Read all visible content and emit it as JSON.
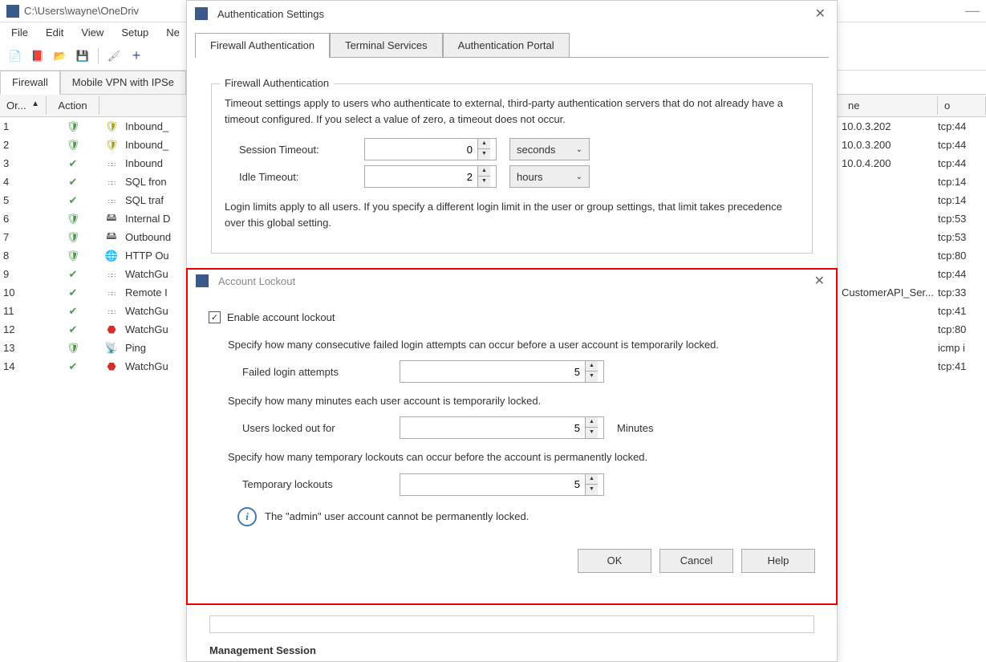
{
  "main_window": {
    "title_path": "C:\\Users\\wayne\\OneDriv",
    "menus": [
      "File",
      "Edit",
      "View",
      "Setup",
      "Ne"
    ],
    "tabs": [
      "Firewall",
      "Mobile VPN with IPSe"
    ],
    "grid": {
      "headers": {
        "or": "Or... ",
        "action": "Action",
        "name": "ne",
        "to": "o"
      },
      "rows": [
        {
          "or": "1",
          "action": "shield",
          "ico": "shield-y",
          "name": "Inbound_",
          "to": "10.0.3.202",
          "port": "tcp:44"
        },
        {
          "or": "2",
          "action": "shield",
          "ico": "shield-y",
          "name": "Inbound_",
          "to": "10.0.3.200",
          "port": "tcp:44"
        },
        {
          "or": "3",
          "action": "check",
          "ico": "dots",
          "name": "Inbound",
          "to": "10.0.4.200",
          "port": "tcp:44"
        },
        {
          "or": "4",
          "action": "check",
          "ico": "dots",
          "name": "SQL fron",
          "to": "",
          "port": "tcp:14"
        },
        {
          "or": "5",
          "action": "check",
          "ico": "dots",
          "name": "SQL traf",
          "to": "",
          "port": "tcp:14"
        },
        {
          "or": "6",
          "action": "shield",
          "ico": "srv",
          "name": "Internal D",
          "to": "",
          "port": "tcp:53"
        },
        {
          "or": "7",
          "action": "shield",
          "ico": "srv",
          "name": "Outbound",
          "to": "",
          "port": "tcp:53"
        },
        {
          "or": "8",
          "action": "shield",
          "ico": "globe",
          "name": "HTTP Ou",
          "to": "",
          "port": "tcp:80"
        },
        {
          "or": "9",
          "action": "check",
          "ico": "dots",
          "name": "WatchGu",
          "to": "",
          "port": "tcp:44"
        },
        {
          "or": "10",
          "action": "check",
          "ico": "dots",
          "name": "Remote I",
          "to": "CustomerAPI_Ser...",
          "port": "tcp:33"
        },
        {
          "or": "11",
          "action": "check",
          "ico": "dots",
          "name": "WatchGu",
          "to": "",
          "port": "tcp:41"
        },
        {
          "or": "12",
          "action": "check",
          "ico": "red",
          "name": "WatchGu",
          "to": "",
          "port": "tcp:80"
        },
        {
          "or": "13",
          "action": "shield",
          "ico": "ping",
          "name": "Ping",
          "to": "",
          "port": "icmp i"
        },
        {
          "or": "14",
          "action": "check",
          "ico": "red",
          "name": "WatchGu",
          "to": "",
          "port": "tcp:41"
        }
      ]
    }
  },
  "auth_dialog": {
    "title": "Authentication Settings",
    "tabs": [
      "Firewall Authentication",
      "Terminal Services",
      "Authentication Portal"
    ],
    "fieldset_legend": "Firewall Authentication",
    "desc1": "Timeout settings apply to users who authenticate to external, third-party authentication servers that do not already have a timeout configured. If you select a value of zero, a timeout does not occur.",
    "session_timeout_label": "Session Timeout:",
    "session_timeout_value": "0",
    "session_timeout_unit": "seconds",
    "idle_timeout_label": "Idle Timeout:",
    "idle_timeout_value": "2",
    "idle_timeout_unit": "hours",
    "desc2": "Login limits apply to all users. If you specify a different login limit in the user or group settings, that limit takes precedence over this global setting.",
    "mgmt_session": "Management Session"
  },
  "lockout_dialog": {
    "title": "Account Lockout",
    "enable_label": "Enable account lockout",
    "enable_checked": true,
    "failed_desc": "Specify how many consecutive failed login attempts can occur before a user account is temporarily locked.",
    "failed_label": "Failed login attempts",
    "failed_value": "5",
    "locked_desc": "Specify how many minutes each user account is temporarily locked.",
    "locked_label": "Users locked out for",
    "locked_value": "5",
    "locked_unit": "Minutes",
    "temp_desc": "Specify how many temporary lockouts can occur before the account is permanently locked.",
    "temp_label": "Temporary lockouts",
    "temp_value": "5",
    "admin_note": "The \"admin\" user account cannot be permanently locked.",
    "buttons": {
      "ok": "OK",
      "cancel": "Cancel",
      "help": "Help"
    }
  }
}
